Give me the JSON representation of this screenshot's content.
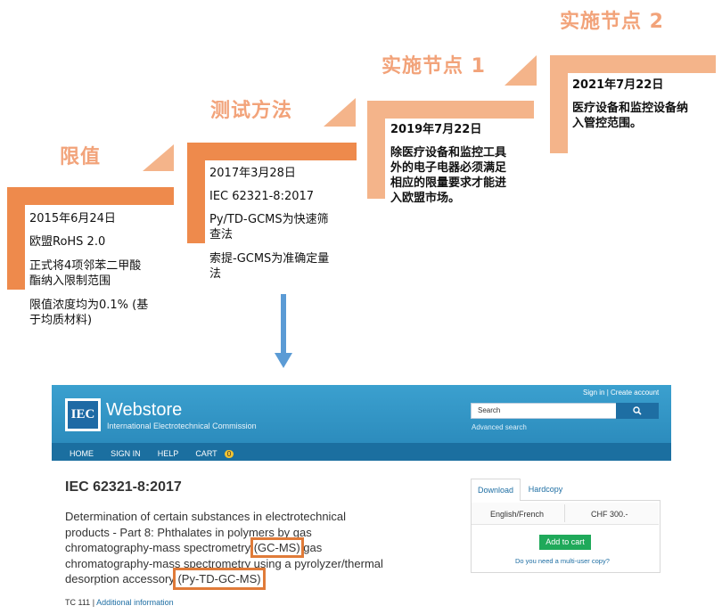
{
  "timeline": {
    "stage1": {
      "title": "限值",
      "date": "2015年6月24日",
      "line1": "欧盟RoHS 2.0",
      "line2a": "正式将4项邻苯二甲酸",
      "line2b": "酯纳入限制范围",
      "line3a": "限值浓度均为0.1% (基",
      "line3b": "于均质材料)"
    },
    "stage2": {
      "title": "测试方法",
      "date": "2017年3月28日",
      "line1": "IEC 62321-8:2017",
      "line2a": "Py/TD-GCMS为快速筛",
      "line2b": "查法",
      "line3a": "索提-GCMS为准确定量",
      "line3b": "法"
    },
    "stage3": {
      "title": "实施节点 1",
      "date": "2019年7月22日",
      "line1a": "除医疗设备和监控工具",
      "line1b": "外的电子电器必须满足",
      "line1c": "相应的限量要求才能进",
      "line1d": "入欧盟市场。"
    },
    "stage4": {
      "title": "实施节点 2",
      "date": "2021年7月22日",
      "line1a": "医疗设备和监控设备纳",
      "line1b": "入管控范围。"
    }
  },
  "webstore": {
    "logo_text": "IEC",
    "brand": "Webstore",
    "subtitle": "International Electrotechnical Commission",
    "sign_in": "Sign in",
    "sep": "|",
    "create_account": "Create account",
    "search_placeholder": "Search",
    "advanced_search": "Advanced search",
    "nav": {
      "home": "HOME",
      "signin": "SIGN IN",
      "help": "HELP",
      "cart": "CART",
      "cart_count": "0"
    },
    "product_title": "IEC 62321-8:2017",
    "desc1": "Determination of certain substances in electrotechnical",
    "desc2": "products - Part 8: Phthalates in polymers by gas",
    "desc3a": "chromatography-mass spectrometry ",
    "desc3b": "(GC-MS)",
    "desc3c": " gas",
    "desc4": "chromatography-mass spectrometry using a pyrolyzer/thermal",
    "desc5a": "desorption accessory ",
    "desc5b": "(Py-TD-GC-MS)",
    "tc": "TC 111",
    "tc_sep": "|",
    "additional": "Additional information",
    "tab_download": "Download",
    "tab_hardcopy": "Hardcopy",
    "language": "English/French",
    "price": "CHF 300.-",
    "add_to_cart": "Add to cart",
    "multi_user": "Do you need a multi-user copy?"
  },
  "colors": {
    "orange": "#ee8a4c",
    "orange_light": "#f4b48a",
    "title_orange": "#f2a37a",
    "highlight_box": "#e07b39",
    "arrow_blue": "#5b9bd5",
    "iec_blue": "#2c8cbd"
  }
}
